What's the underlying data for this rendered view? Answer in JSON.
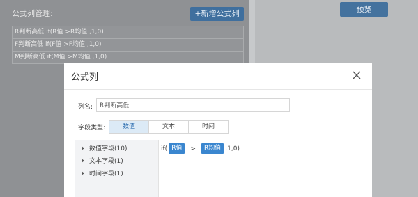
{
  "background": {
    "section_title": "公式列管理:",
    "add_formula_button": "+新增公式列",
    "preview_button": "预览",
    "formula_rows": [
      "R判断高低 if(R值 >R均值 ,1,0)",
      "F判断高低 if(F值 >F均值 ,1,0)",
      "M判断高低 if(M值 >M均值 ,1,0)"
    ]
  },
  "dialog": {
    "title": "公式列",
    "column_name_label": "列名:",
    "column_name_value": "R判断高低",
    "field_type_label": "字段类型:",
    "field_types": [
      "数值",
      "文本",
      "时间"
    ],
    "selected_field_type": "数值",
    "field_tree": [
      "数值字段(10)",
      "文本字段(1)",
      "时间字段(1)"
    ],
    "formula": {
      "prefix": "if(",
      "operand_1": "R值",
      "operator": ">",
      "operand_2": "R均值",
      "suffix": ",1,0)"
    }
  },
  "colors": {
    "primary": "#3a86cf",
    "active_tab_bg": "#dceaf6"
  },
  "icons": {
    "close": "close-icon",
    "tree_expand": "triangle-right-icon"
  }
}
